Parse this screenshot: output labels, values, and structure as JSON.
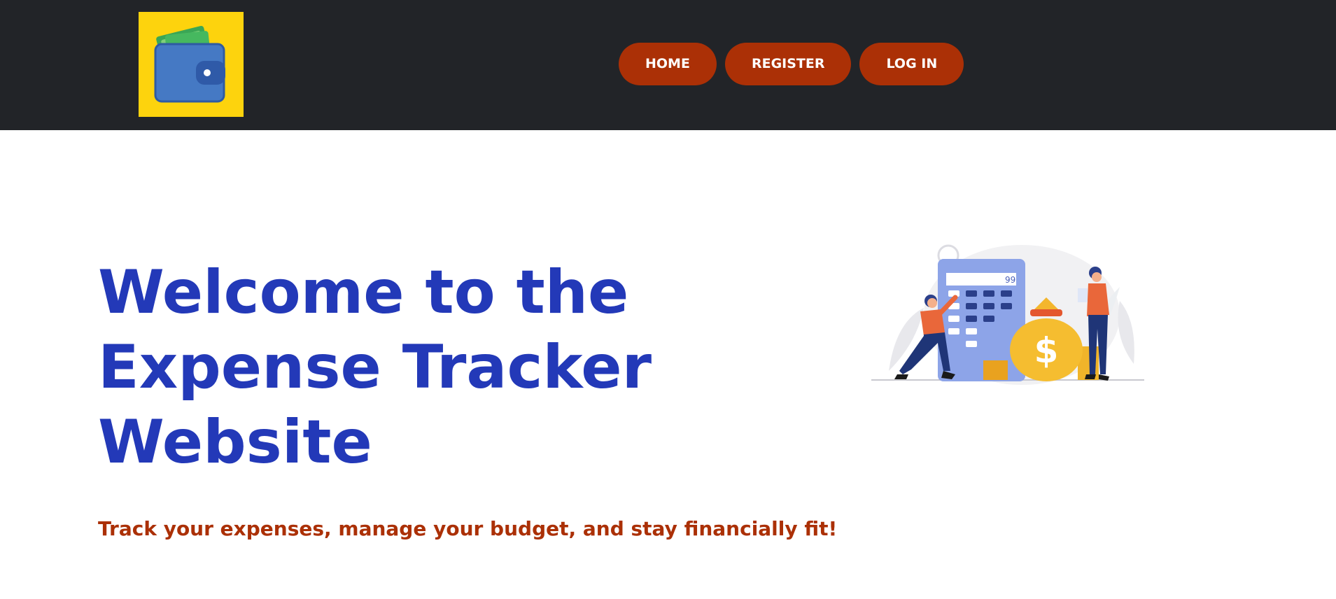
{
  "header": {
    "logo_icon": "wallet-icon",
    "logo_bg_color": "#fdd30d",
    "nav": [
      {
        "label": "HOME"
      },
      {
        "label": "REGISTER"
      },
      {
        "label": "LOG IN"
      }
    ],
    "nav_button_color": "#ab3006",
    "bar_color": "#222428"
  },
  "hero": {
    "title_lines": [
      "Welcome to the",
      "Expense Tracker",
      "Website"
    ],
    "subtitle": "Track your expenses, manage your budget, and stay financially fit!",
    "title_color": "#2339b8",
    "subtitle_color": "#ab3006",
    "illustration": {
      "icon": "finance-illustration",
      "calculator_display": "99",
      "bag_symbol": "$"
    }
  }
}
